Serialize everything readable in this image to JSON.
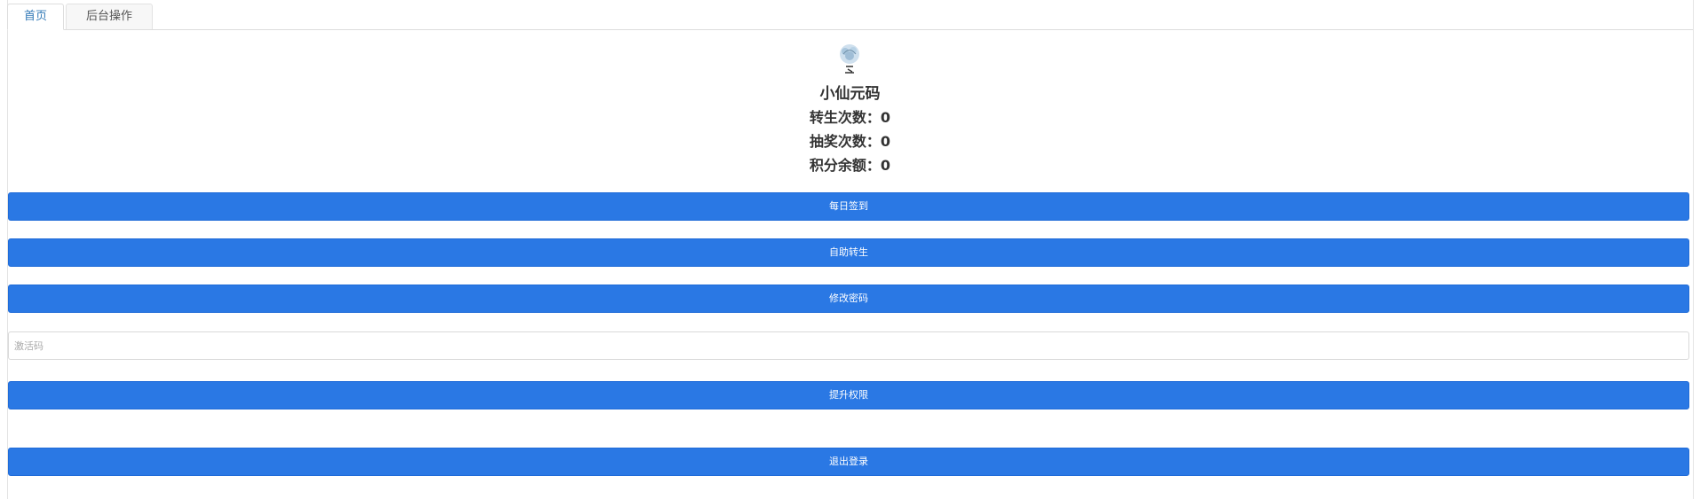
{
  "tabs": [
    {
      "label": "首页",
      "active": true
    },
    {
      "label": "后台操作",
      "active": false
    }
  ],
  "profile": {
    "avatar_icon": "avatar-icon",
    "name": "小仙元码",
    "rebirth_count": "转生次数：0",
    "lottery_count": "抽奖次数：0",
    "points_balance": "积分余额：0"
  },
  "actions": {
    "daily_checkin": "每日签到",
    "self_rebirth": "自助转生",
    "change_password": "修改密码",
    "upgrade_permission": "提升权限",
    "logout": "退出登录"
  },
  "activation": {
    "placeholder": "激活码",
    "value": ""
  },
  "colors": {
    "primary": "#2a78e4",
    "tab_active_text": "#337ab7"
  }
}
